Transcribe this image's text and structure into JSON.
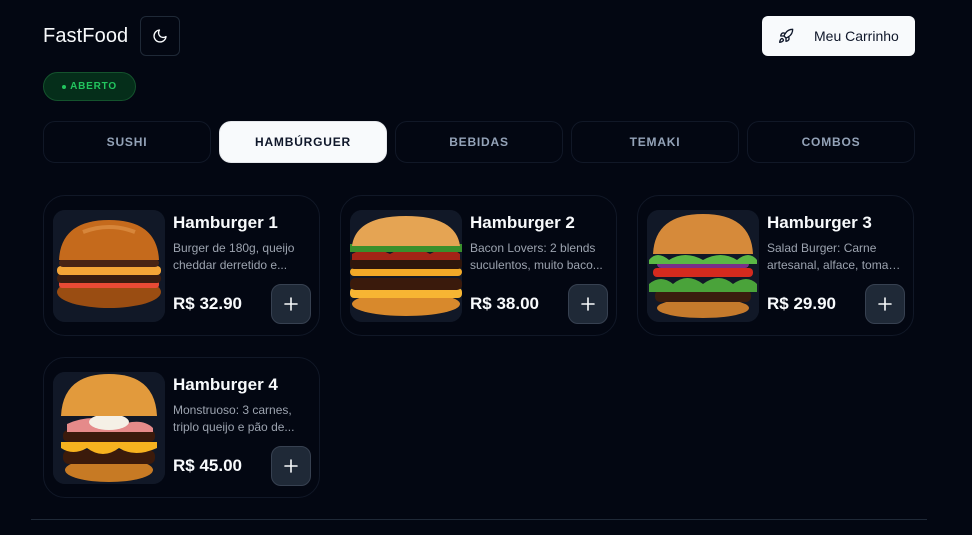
{
  "header": {
    "title": "FastFood",
    "theme_icon": "moon-icon",
    "cart_label": "Meu Carrinho",
    "cart_icon": "rocket-icon"
  },
  "status": {
    "label": "ABERTO",
    "color": "#22c55e"
  },
  "tabs": [
    {
      "label": "SUSHI",
      "active": false
    },
    {
      "label": "HAMBÚRGUER",
      "active": true
    },
    {
      "label": "BEBIDAS",
      "active": false
    },
    {
      "label": "TEMAKI",
      "active": false
    },
    {
      "label": "COMBOS",
      "active": false
    }
  ],
  "products": [
    {
      "name": "Hamburger 1",
      "desc_line1": "Burger de 180g, queijo",
      "desc_line2": "cheddar derretido e...",
      "price": "R$ 32.90"
    },
    {
      "name": "Hamburger 2",
      "desc_line1": "Bacon Lovers: 2 blends",
      "desc_line2": "suculentos, muito baco...",
      "price": "R$ 38.00"
    },
    {
      "name": "Hamburger 3",
      "desc_line1": "Salad Burger: Carne",
      "desc_line2": "artesanal, alface, tomat...",
      "price": "R$ 29.90"
    },
    {
      "name": "Hamburger 4",
      "desc_line1": "Monstruoso: 3 carnes,",
      "desc_line2": "triplo queijo e pão de...",
      "price": "R$ 45.00"
    }
  ],
  "add_icon": "plus-icon",
  "product_image_icon": "burger-photo"
}
